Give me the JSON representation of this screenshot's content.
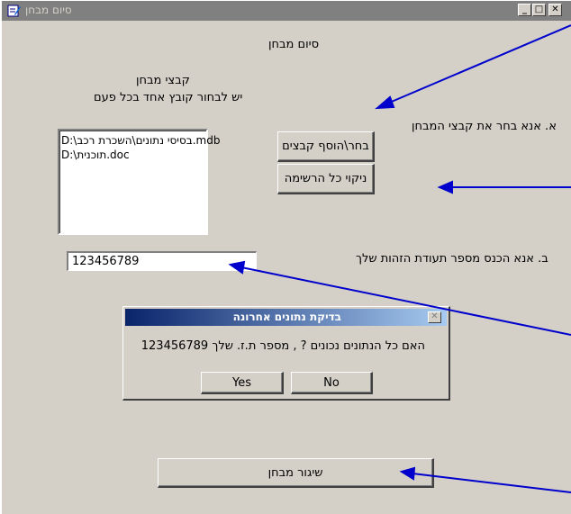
{
  "window": {
    "title": "סיום מבחן",
    "buttons": {
      "minimize": "_",
      "maximize": "□",
      "close": "✕"
    }
  },
  "main": {
    "heading": "סיום מבחן",
    "files_label": "קבצי מבחן",
    "instruction": "יש לבחור קובץ אחד בכל פעם",
    "step_a": "א. אנא בחר את קבצי המבחן",
    "choose_add_button": "בחר\\הוסף קבצים",
    "clear_list_button": "ניקוי כל הרשימה",
    "files": [
      "D:\\בסיסי נתונים\\השכרת רכב.mdb",
      "D:\\תוכנית.doc"
    ],
    "step_b": "ב. אנא הכנס מספר תעודת הזהות שלך",
    "id_value": "123456789",
    "submit_button": "שיגור מבחן"
  },
  "dialog": {
    "title": "בדיקת נתונים אחרונה",
    "message": "האם כל הנתונים נכונים ? , מספר ת.ז. שלך 123456789",
    "yes_button": "Yes",
    "no_button": "No",
    "close": "✕"
  },
  "colors": {
    "window_bg": "#d4d0c8",
    "titlebar_inactive": "#808080",
    "dialog_title": "#0a246a",
    "arrow": "#0000cc"
  }
}
